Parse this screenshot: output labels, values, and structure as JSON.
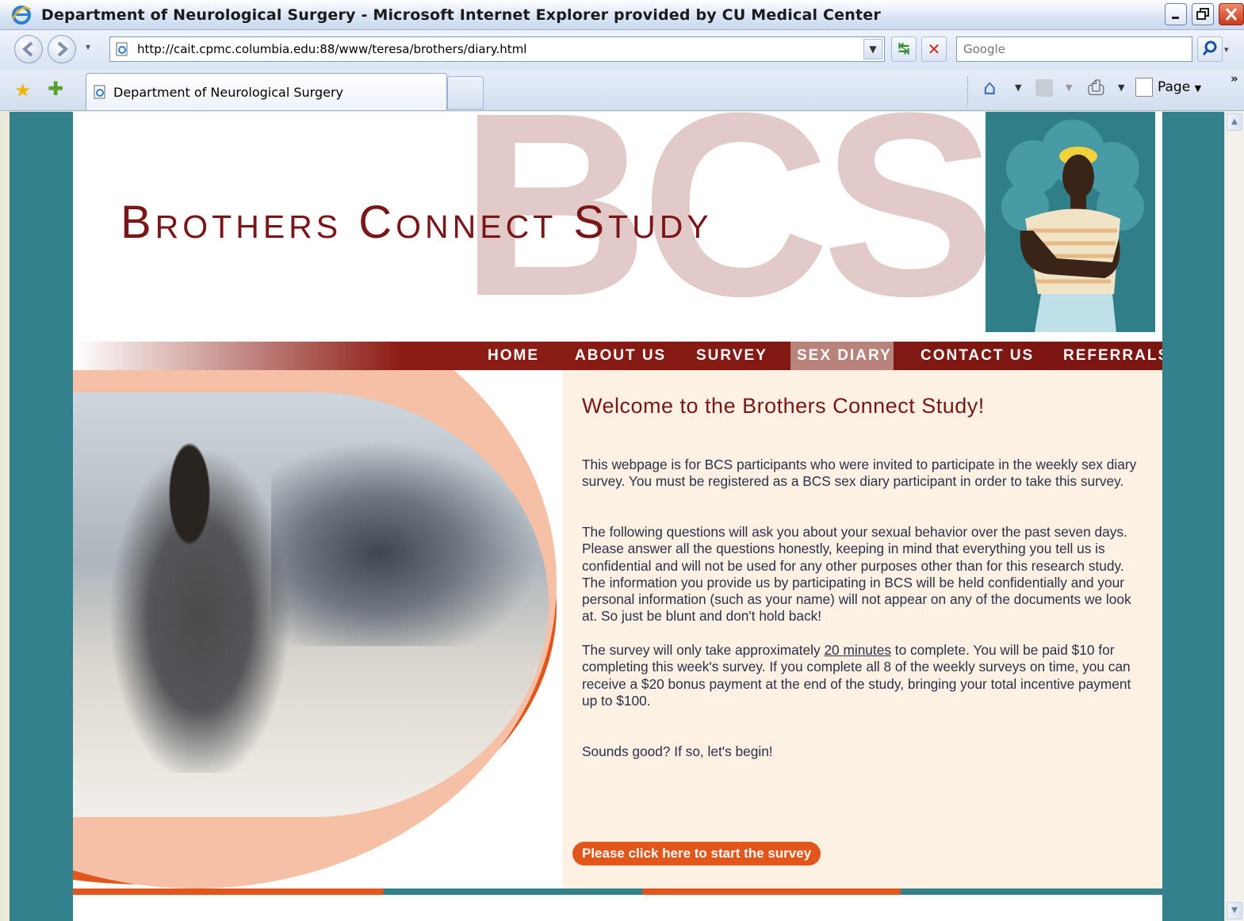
{
  "window": {
    "title": "Department of Neurological Surgery - Microsoft Internet Explorer provided by CU Medical Center"
  },
  "toolbar": {
    "address": "http://cait.cpmc.columbia.edu:88/www/teresa/brothers/diary.html",
    "search_placeholder": "Google",
    "page_menu_label": "Page",
    "more_label": "»"
  },
  "tabs": [
    {
      "label": "Department of Neurological Surgery",
      "active": true
    }
  ],
  "site": {
    "title": "Brothers Connect Study",
    "logo_letters": "BCS",
    "nav": [
      {
        "label": "HOME",
        "active": false
      },
      {
        "label": "ABOUT US",
        "active": false
      },
      {
        "label": "SURVEY",
        "active": false
      },
      {
        "label": "SEX DIARY",
        "active": true
      },
      {
        "label": "CONTACT US",
        "active": false
      },
      {
        "label": "REFERRALS",
        "active": false
      }
    ]
  },
  "content": {
    "heading": "Welcome to the Brothers Connect Study!",
    "para1": "This webpage is for BCS participants who were invited to participate in the weekly sex diary survey.  You must be registered as a BCS sex diary participant in order to take this survey.",
    "para2": "The following questions will ask you about your sexual behavior over the past seven days.  Please answer all the questions honestly, keeping in mind that everything you tell us is confidential and will not be used for any other purposes other than for this research study. The information you provide us by participating in BCS will be held confidentially and your personal information (such as your name) will not appear on any of the documents we look at.  So just be blunt and don't hold back!",
    "para3_before": "The survey will only take approximately ",
    "para3_link": "20 minutes",
    "para3_after": " to complete.  You will be paid $10 for completing this week's survey.  If you complete all 8 of the weekly surveys on time, you can receive a $20 bonus payment at the end of the study, bringing your total incentive payment up to $100.",
    "para4": "Sounds good?  If so, let's begin!",
    "start_button": "Please click here to start the survey"
  },
  "colors": {
    "accent_orange": "#e2561b",
    "teal": "#33818c",
    "maroon": "#7a1518",
    "panel": "#fcf1e2"
  }
}
